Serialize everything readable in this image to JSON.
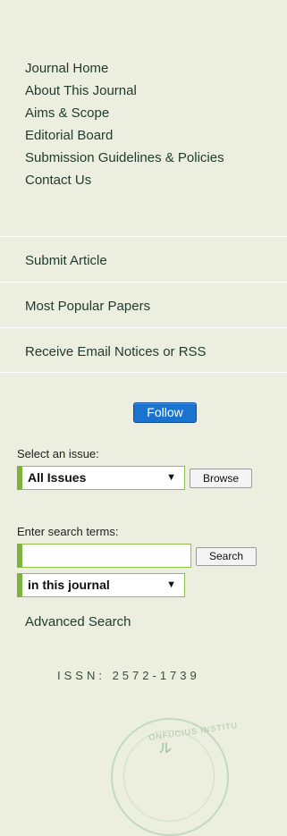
{
  "nav": {
    "items": [
      "Journal Home",
      "About This Journal",
      "Aims & Scope",
      "Editorial Board",
      "Submission Guidelines & Policies",
      "Contact Us"
    ]
  },
  "links": {
    "submit": "Submit Article",
    "popular": "Most Popular Papers",
    "email": "Receive Email Notices or RSS"
  },
  "follow": {
    "label": "Follow"
  },
  "issue": {
    "label": "Select an issue:",
    "selected": "All Issues",
    "browse": "Browse"
  },
  "search": {
    "label": "Enter search terms:",
    "value": "",
    "button": "Search",
    "scope": "in this journal",
    "advanced": "Advanced Search"
  },
  "issn": "ISSN: 2572-1739",
  "seal": {
    "text": "ONFUCIUS INSTITU",
    "mark": "ル"
  }
}
